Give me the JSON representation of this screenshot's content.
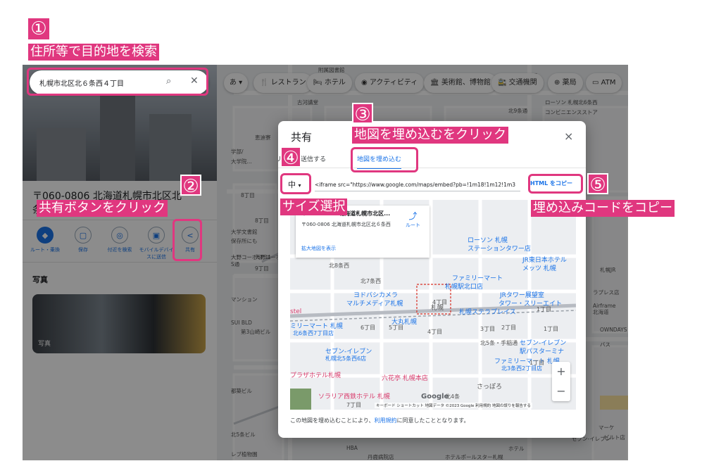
{
  "annotations": {
    "step1": {
      "num": "①",
      "text": "住所等で目的地を検索"
    },
    "step2": {
      "num": "②",
      "text": "共有ボタンをクリック"
    },
    "step3": {
      "num": "③",
      "text": "地図を埋め込むをクリック"
    },
    "step4": {
      "num": "④",
      "text": "サイズ選択"
    },
    "step5": {
      "num": "⑤",
      "text": "埋め込みコードをコピー"
    }
  },
  "search": {
    "value": "札幌市北区北６条西４丁目",
    "icon": "search-icon",
    "close_icon": "close-icon"
  },
  "panel": {
    "address": "〒060-0806 北海道札幌市北区北",
    "address2": "条",
    "actions": [
      {
        "icon": "directions-icon",
        "label": "ルート・乗換"
      },
      {
        "icon": "bookmark-icon",
        "label": "保存"
      },
      {
        "icon": "nearby-icon",
        "label": "付近を検索"
      },
      {
        "icon": "phone-icon",
        "label": "モバイルデバイスに送信"
      },
      {
        "icon": "share-icon",
        "label": "共有"
      }
    ],
    "photos_heading": "写真",
    "photo_label": "写真"
  },
  "chips": {
    "lang": "あ",
    "items": [
      "レストラン",
      "ホテル",
      "アクティビティ",
      "美術館、博物館",
      "交通機関",
      "薬局",
      "ATM"
    ]
  },
  "map_labels": [
    "附属図書館",
    "古河講堂",
    "北9条通",
    "恵迪寮",
    "学部/",
    "大学院...",
    "大学文書館",
    "保存所にも",
    "8丁目",
    "8丁目",
    "9丁目",
    "大野コーポSP34",
    "大野コーポSP34",
    "S通",
    "マンション",
    "SUI BLD",
    "第3山崎ビル",
    "都築ビル",
    "北5条ビル",
    "レブ植物園",
    "HBA",
    "ホテル",
    "1丁目",
    "ローソン 札幌北6条西",
    "コンビニエンスストア",
    "1丁目",
    "5丁目",
    "ラプレス店",
    "Airframe",
    "北海道",
    "札幌JR",
    "OWNDAYS",
    "バス",
    "マーケ",
    "ビルト店",
    "セブン-イレブン",
    "丹鹿病院店",
    "ホテルポールスター札幌"
  ],
  "modal": {
    "title": "共有",
    "close": "×",
    "tab_send": "リンクを送信する",
    "tab_embed": "地図を埋め込む",
    "size_value": "中",
    "iframe_code": "<iframe src=\"https://www.google.com/maps/embed?pb=!1m18!1m12!1m3",
    "copy_button": "HTML をコピー",
    "card_address": "〒060-0806 北海道札幌市北区...",
    "card_full": "〒060-0806 北海道札幌市北区北６条西",
    "card_route": "ルート",
    "card_link": "拡大地図を表示",
    "footer_prefix": "この地図を埋め込むことにより、",
    "footer_link": "利用規約",
    "footer_suffix": "に同意したこととなります。",
    "attribution": "キーボード ショートカット  地図データ ©2023 Google  利用規約  地図の誤りを報告する",
    "google": "Google",
    "zoom_in": "+",
    "zoom_out": "−",
    "map_labels": [
      "北8条西",
      "北7条西",
      "ヨドバシカメラ",
      "マルチメディア札幌",
      "ファミリーマート",
      "札幌駅北口店",
      "ローソン 札幌",
      "ステーションタワー店",
      "JR東日本ホテル",
      "メッツ 札幌",
      "JRタワー展望室",
      "タワー・スリーエイト",
      "札幌",
      "札幌ステラプレイス",
      "4丁目",
      "6丁目",
      "5丁目",
      "4丁目",
      "3丁目",
      "2丁目",
      "1丁目",
      "大丸札幌",
      "ミリーマート 札幌",
      "北6条西7丁目店",
      "セブン-イレブン",
      "札幌北5条西6店",
      "プラザホテル札幌",
      "六花亭 札幌本店",
      "ソラリア西鉄ホテル 札幌",
      "北4条",
      "さっぽろ",
      "7丁目",
      "北5条・手稲通",
      "ファミリーマート 札幌",
      "北3条西2丁目店",
      "セブン-イレブン",
      "駅パスターミナ",
      "1丁目",
      "1丁目",
      "stel"
    ]
  },
  "colors": {
    "accent": "#e0377f",
    "link": "#1a73e8",
    "map_bg": "#e9ebee"
  }
}
